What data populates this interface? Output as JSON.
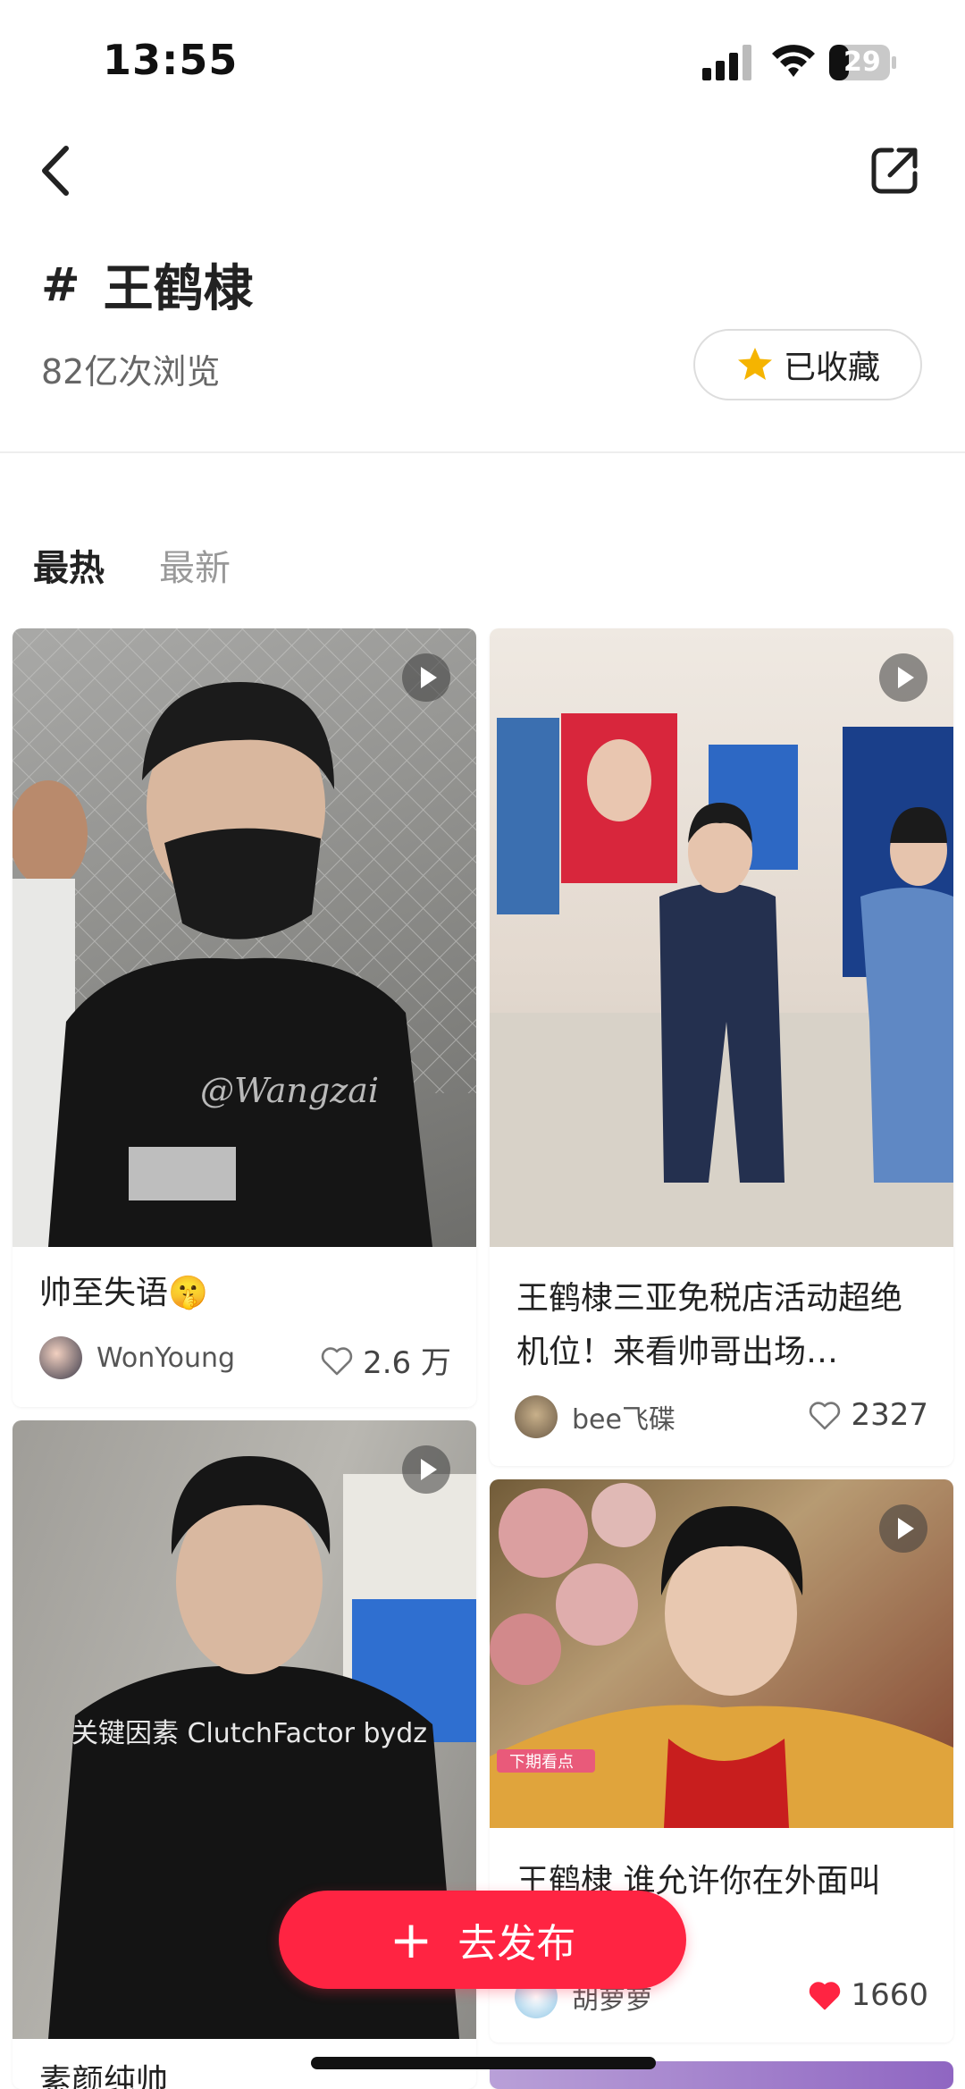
{
  "status_bar": {
    "time": "13:55",
    "battery": "29"
  },
  "topic": {
    "hash": "#",
    "title": "王鹤棣",
    "views": "82亿次浏览",
    "favorite_label": "已收藏"
  },
  "tabs": [
    {
      "label": "最热"
    },
    {
      "label": "最新"
    }
  ],
  "posts": [
    {
      "title": "帅至失语🤫",
      "author": "WonYoung",
      "likes": "2.6 万",
      "liked": false,
      "video": true,
      "watermark": "@Wangzai"
    },
    {
      "title": "王鹤棣三亚免税店活动超绝机位！来看帅哥出场…",
      "author": "bee飞碟",
      "likes": "2327",
      "liked": false,
      "video": true
    },
    {
      "title": "",
      "author": "",
      "likes": "",
      "video": true,
      "shirt_text": "关键因素 ClutchFactor bydz"
    },
    {
      "title": "王鹤棣 谁允许你在外面叫",
      "author": "胡萝萝",
      "likes": "1660",
      "liked": true,
      "video": true,
      "overlay": "下期看点"
    },
    {
      "title": "素颜纯帅"
    }
  ],
  "publish": {
    "plus": "+",
    "label": "去发布"
  },
  "colors": {
    "accent": "#ff2442",
    "star": "#f5b400"
  },
  "icons": [
    "back-icon",
    "share-icon",
    "star-icon",
    "heart-icon",
    "play-icon",
    "plus-icon"
  ]
}
